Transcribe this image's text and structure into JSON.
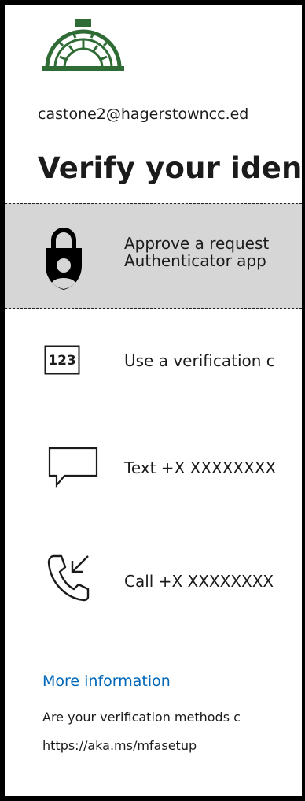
{
  "account": {
    "email": "castone2@hagerstowncc.ed"
  },
  "header": {
    "title": "Verify your ident"
  },
  "options": [
    {
      "icon": "authenticator-lock-icon",
      "line1": "Approve a request",
      "line2": "Authenticator app"
    },
    {
      "icon": "code-123-icon",
      "line1": "Use a verification c"
    },
    {
      "icon": "message-bubble-icon",
      "line1": "Text +X XXXXXXXX"
    },
    {
      "icon": "phone-call-icon",
      "line1": "Call +X XXXXXXXX"
    }
  ],
  "links": {
    "more_info": "More information"
  },
  "footer": {
    "line1": "Are your verification methods c",
    "line2": "https://aka.ms/mfasetup"
  },
  "colors": {
    "selected_bg": "#d6d6d6",
    "link": "#0067b8",
    "logo_green": "#2e6b35"
  },
  "icon_labels": {
    "code_box": "123"
  }
}
